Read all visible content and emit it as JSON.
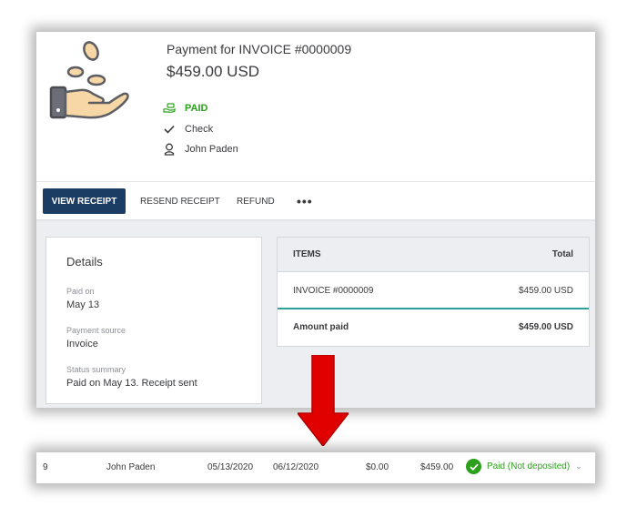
{
  "payment": {
    "title": "Payment for INVOICE #0000009",
    "amount": "$459.00 USD",
    "status": "PAID",
    "method": "Check",
    "customer": "John Paden"
  },
  "actions": {
    "view_receipt": "VIEW RECEIPT",
    "resend_receipt": "RESEND RECEIPT",
    "refund": "REFUND",
    "more": "•••"
  },
  "details": {
    "title": "Details",
    "paid_on_label": "Paid on",
    "paid_on_value": "May 13",
    "source_label": "Payment source",
    "source_value": "Invoice",
    "summary_label": "Status summary",
    "summary_value": "Paid on May 13. Receipt sent"
  },
  "items": {
    "header_items": "ITEMS",
    "header_total": "Total",
    "rows": [
      {
        "name": "INVOICE #0000009",
        "total": "$459.00 USD"
      }
    ],
    "amount_paid_label": "Amount paid",
    "amount_paid_value": "$459.00 USD"
  },
  "list_row": {
    "number": "9",
    "customer": "John Paden",
    "date": "05/13/2020",
    "due_date": "06/12/2020",
    "balance": "$0.00",
    "total": "$459.00",
    "status": "Paid (Not deposited)"
  },
  "icons": {
    "hero": "hand-coins-icon",
    "paid": "money-hand-icon",
    "method": "check-icon",
    "customer": "person-icon",
    "arrow": "arrow-down-icon",
    "status": "check-circle-icon"
  },
  "colors": {
    "primary_button": "#1b3c63",
    "paid_green": "#2ca01c",
    "divider_teal": "#2ca09a",
    "arrow_red": "#e00000"
  }
}
